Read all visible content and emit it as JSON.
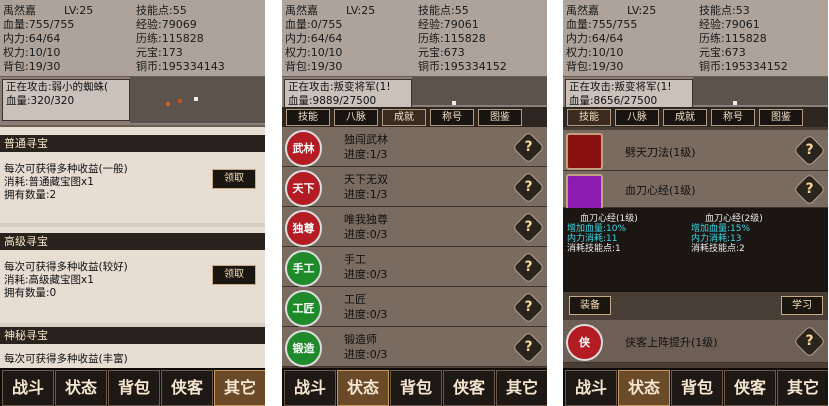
{
  "panel1": {
    "stats": {
      "name": "禹然嘉",
      "lv": "LV:25",
      "skill_points": "技能点:55",
      "hp": "血量:755/755",
      "exp": "经验:79069",
      "mp": "内力:64/64",
      "history": "历练:115828",
      "power": "权力:10/10",
      "yuanbao": "元宝:173",
      "bag": "背包:19/30",
      "copper": "铜币:195334143"
    },
    "attack": {
      "target": "正在攻击:弱小的蜘蛛(",
      "hp": "血量:320/320"
    },
    "treasures": [
      {
        "title": "普通寻宝",
        "line1": "每次可获得多种收益(一般)",
        "line2": "消耗:普通藏宝图x1",
        "line3": "拥有数量:2",
        "button": "领取"
      },
      {
        "title": "高级寻宝",
        "line1": "每次可获得多种收益(较好)",
        "line2": "消耗:高级藏宝图x1",
        "line3": "拥有数量:0",
        "button": "领取"
      },
      {
        "title": "神秘寻宝",
        "line1": "每次可获得多种收益(丰富)",
        "line2": "",
        "line3": "",
        "button": ""
      }
    ]
  },
  "panel2": {
    "stats": {
      "name": "禹然嘉",
      "lv": "LV:25",
      "skill_points": "技能点:55",
      "hp": "血量:0/755",
      "exp": "经验:79061",
      "mp": "内力:64/64",
      "history": "历练:115828",
      "power": "权力:10/10",
      "yuanbao": "元宝:673",
      "bag": "背包:19/30",
      "copper": "铜币:195334152"
    },
    "attack": {
      "target": "正在攻击:叛变将军(1!",
      "hp": "血量:9889/27500"
    },
    "tabs": [
      "技能",
      "八脉",
      "成就",
      "称号",
      "图鉴"
    ],
    "achievements": [
      {
        "badge": "武林",
        "name": "独闯武林",
        "progress": "进度:1/3",
        "color": "#c0202a"
      },
      {
        "badge": "天下",
        "name": "天下无双",
        "progress": "进度:1/3",
        "color": "#c0202a"
      },
      {
        "badge": "独尊",
        "name": "唯我独尊",
        "progress": "进度:0/3",
        "color": "#c0202a"
      },
      {
        "badge": "手工",
        "name": "手工",
        "progress": "进度:0/3",
        "color": "#1f8a2a"
      },
      {
        "badge": "工匠",
        "name": "工匠",
        "progress": "进度:0/3",
        "color": "#1f8a2a"
      },
      {
        "badge": "锻造",
        "name": "锻造师",
        "progress": "进度:0/3",
        "color": "#1f8a2a"
      }
    ]
  },
  "panel3": {
    "stats": {
      "name": "禹然嘉",
      "lv": "LV:25",
      "skill_points": "技能点:53",
      "hp": "血量:755/755",
      "exp": "经验:79061",
      "mp": "内力:64/64",
      "history": "历练:115828",
      "power": "权力:10/10",
      "yuanbao": "元宝:673",
      "bag": "背包:19/30",
      "copper": "铜币:195334152"
    },
    "attack": {
      "target": "正在攻击:叛变将军(1!",
      "hp": "血量:8656/27500"
    },
    "tabs": [
      "技能",
      "八脉",
      "成就",
      "称号",
      "图鉴"
    ],
    "skills": [
      {
        "name": "劈天刀法(1级)"
      },
      {
        "name": "血刀心经(1级)"
      }
    ],
    "info": {
      "left_title": "血刀心经(1级)",
      "left_l1": "增加血量:10%",
      "left_l2": "内力消耗:11",
      "left_l3": "消耗技能点:1",
      "right_title": "血刀心经(2级)",
      "right_l1": "增加血量:15%",
      "right_l2": "内力消耗:13",
      "right_l3": "消耗技能点:2"
    },
    "equip_button": "装备",
    "learn_button": "学习",
    "extra_skill": {
      "badge": "侠",
      "name": "侠客上阵提升(1级)"
    }
  },
  "bottom_nav": [
    "战斗",
    "状态",
    "背包",
    "侠客",
    "其它"
  ],
  "question_mark": "?"
}
